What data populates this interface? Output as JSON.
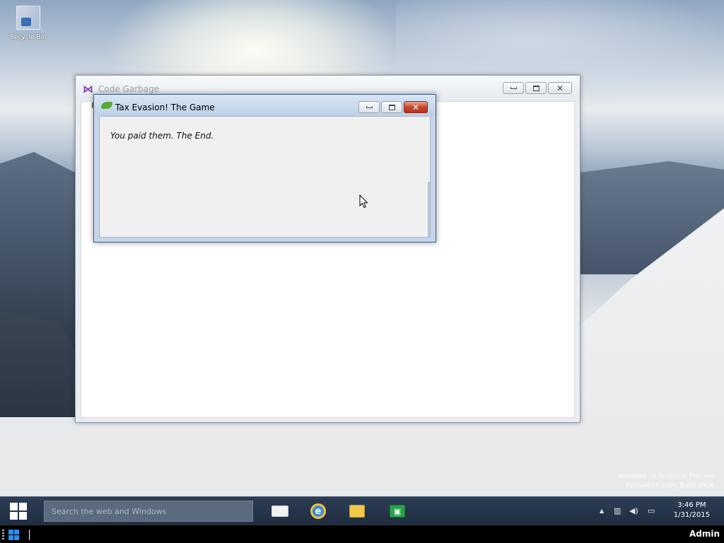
{
  "desktop": {
    "icons": [
      {
        "label": "Recycle Bin"
      }
    ],
    "watermark": {
      "line1": "Windows 10 Technical Preview",
      "line2": "Evaluation copy. Build 9926"
    }
  },
  "main_window": {
    "title": "Code Garbage",
    "menu_stub": "F",
    "controls": {
      "minimize": "–",
      "maximize": "□",
      "close": "✕"
    }
  },
  "dialog": {
    "title": "Tax Evasion! The Game",
    "message": "You paid them. The End.",
    "controls": {
      "minimize": "–",
      "maximize": "□",
      "close": "✕"
    }
  },
  "taskbar": {
    "search_placeholder": "Search the web and Windows",
    "apps": [
      {
        "name": "task-view",
        "icon": "task-view-icon"
      },
      {
        "name": "internet-explorer",
        "icon": "ie-icon",
        "glyph": "e"
      },
      {
        "name": "file-explorer",
        "icon": "folder-icon"
      },
      {
        "name": "store",
        "icon": "store-icon",
        "glyph": "▣"
      }
    ],
    "tray": {
      "chevron": "▲",
      "network": "▥",
      "volume": "◀)",
      "action_center": "▭",
      "time": "3:46 PM",
      "date": "1/31/2015"
    }
  },
  "vm_bar": {
    "user": "Admin"
  }
}
